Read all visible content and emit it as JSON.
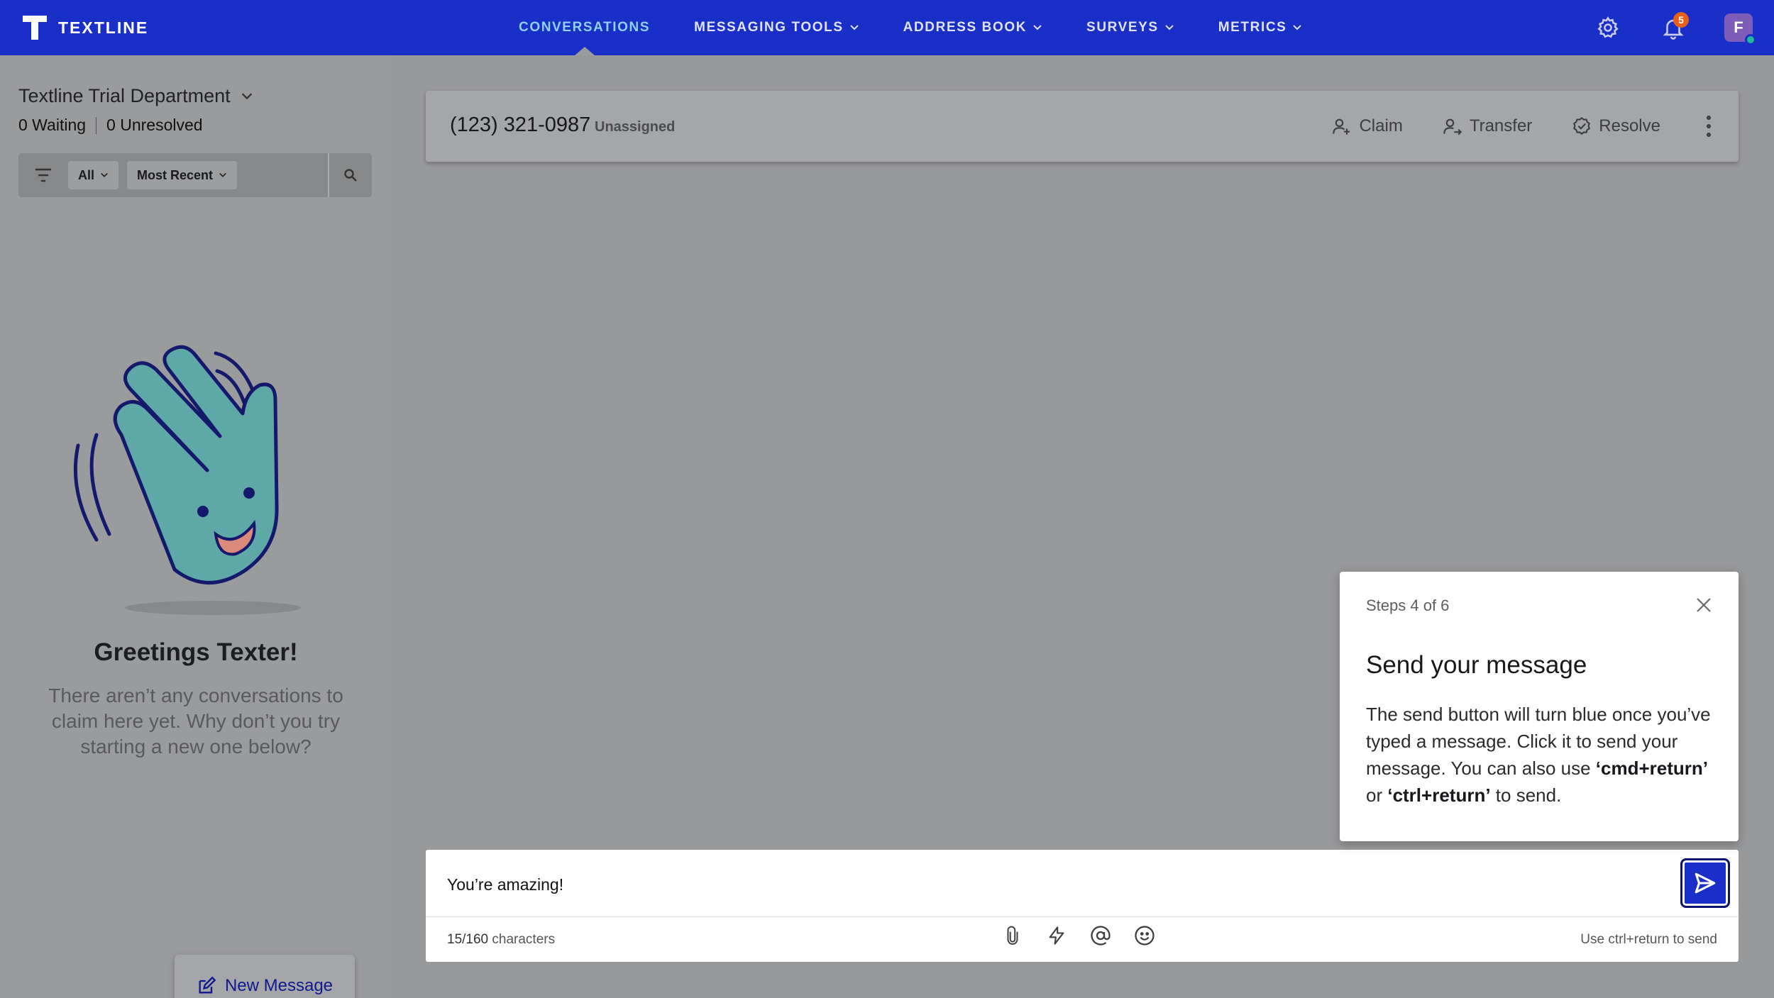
{
  "brand": {
    "name": "TEXTLINE"
  },
  "nav": {
    "items": [
      {
        "label": "CONVERSATIONS",
        "active": true
      },
      {
        "label": "MESSAGING TOOLS",
        "has_menu": true
      },
      {
        "label": "ADDRESS BOOK",
        "has_menu": true
      },
      {
        "label": "SURVEYS",
        "has_menu": true
      },
      {
        "label": "METRICS",
        "has_menu": true
      }
    ],
    "notifications_count": "5",
    "avatar_initial": "F"
  },
  "sidebar": {
    "department": "Textline Trial Department",
    "waiting": "0 Waiting",
    "unresolved": "0 Unresolved",
    "filter_status": "All",
    "filter_sort": "Most Recent",
    "empty_title": "Greetings Texter!",
    "empty_text": "There aren’t any conversations to claim here yet. Why don’t you try starting a new one below?",
    "new_message": "New Message"
  },
  "conversation": {
    "phone": "(123) 321-0987",
    "assignment": "Unassigned",
    "actions": {
      "claim": "Claim",
      "transfer": "Transfer",
      "resolve": "Resolve"
    }
  },
  "composer": {
    "value": "You’re amazing!",
    "char_used": "15/160",
    "char_suffix": " characters",
    "hint": "Use ctrl+return to send"
  },
  "tour": {
    "steps": "Steps 4 of 6",
    "title": "Send your message",
    "body_1": "The send button will turn blue once you’ve typed a message. Click it to send your message. You can also use ",
    "key_1": "‘cmd+return’",
    "body_2": " or ",
    "key_2": "‘ctrl+return’",
    "body_3": " to send."
  },
  "colors": {
    "brand_blue": "#1a2fc7",
    "overlay_gray": "#98999b",
    "accent_teal": "#5ea8a8"
  }
}
